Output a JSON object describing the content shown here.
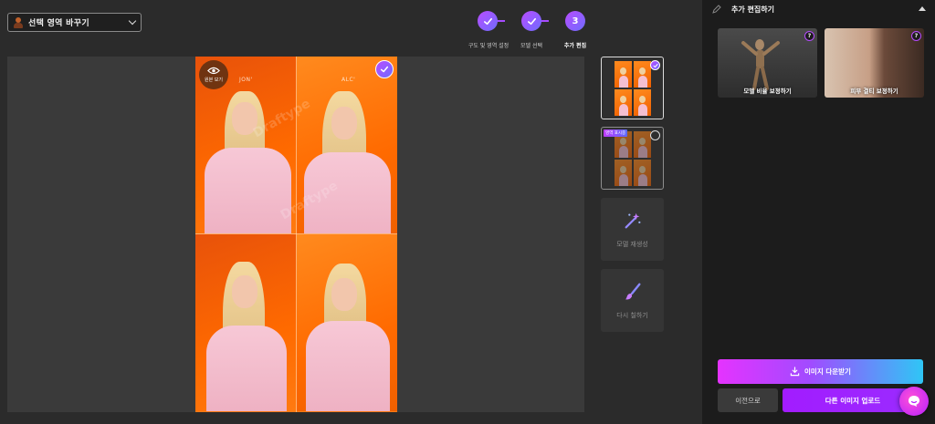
{
  "area_select": {
    "label": "선택 영역 바꾸기"
  },
  "steps": [
    {
      "num": "1",
      "label": "구도 및 영역 설정",
      "state": "done"
    },
    {
      "num": "2",
      "label": "모델 선택",
      "state": "done"
    },
    {
      "num": "3",
      "label": "추가 편집",
      "state": "active"
    }
  ],
  "canvas": {
    "view_original_label": "원본 보기",
    "model_labels": [
      "JON'",
      "ALC'"
    ],
    "watermark": "Draftype"
  },
  "thumbnails": {
    "tag_label": "영역 표시중"
  },
  "tools": [
    {
      "label": "모델 재생성",
      "icon": "magic-wand-icon"
    },
    {
      "label": "다시 칠하기",
      "icon": "paint-brush-icon"
    }
  ],
  "panel": {
    "title": "추가 편집하기",
    "features": [
      {
        "label": "모델 비율 보정하기",
        "help": "?"
      },
      {
        "label": "피부 결티 보정하기",
        "help": "?"
      }
    ],
    "download_label": "이미지 다운받기",
    "prev_label": "이전으로",
    "upload_label": "다른 이미지 업로드"
  },
  "colors": {
    "accent_purple": "#a64bff",
    "photo_background": "#ff7a15",
    "panel_background": "#1c1c1c"
  }
}
